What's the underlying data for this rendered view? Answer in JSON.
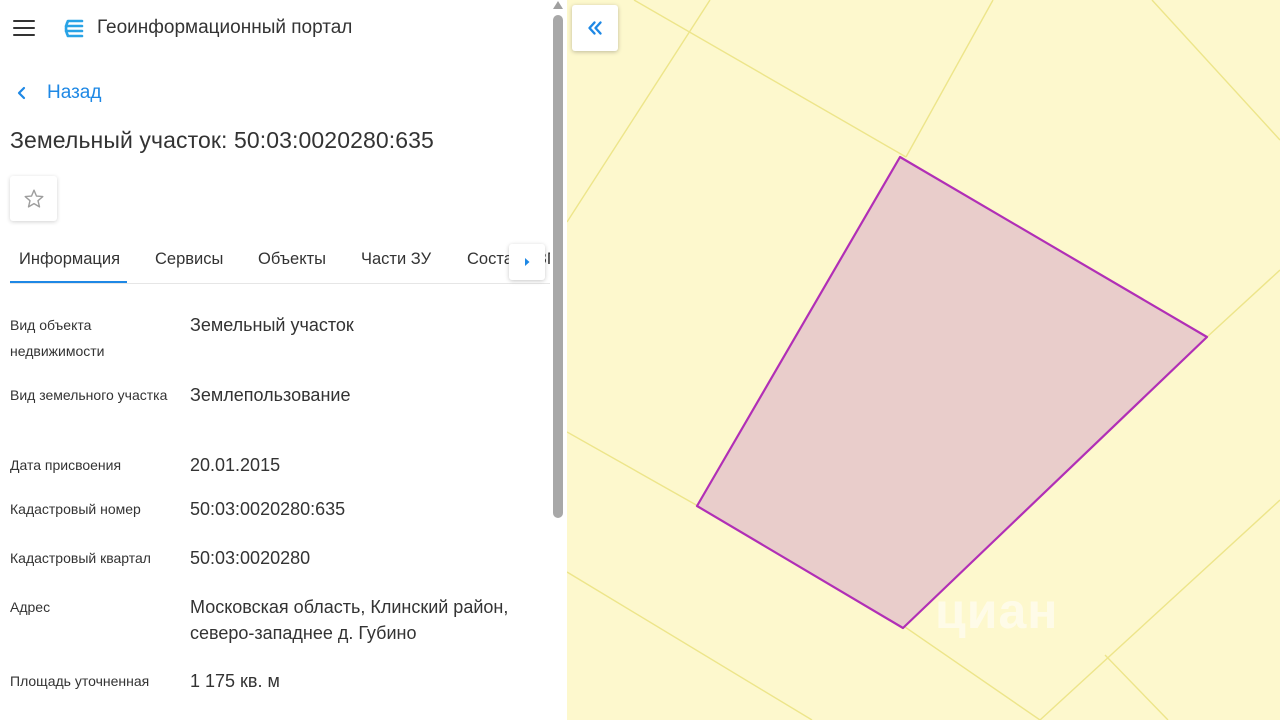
{
  "header": {
    "app_title": "Геоинформационный портал",
    "menu_icon": "hamburger-menu-icon",
    "logo_icon": "portal-logo-icon"
  },
  "navigation": {
    "back_label": "Назад"
  },
  "page": {
    "title": "Земельный участок: 50:03:0020280:635"
  },
  "favorite": {
    "icon": "star-outline-icon"
  },
  "tabs": [
    {
      "label": "Информация",
      "active": true
    },
    {
      "label": "Сервисы",
      "active": false
    },
    {
      "label": "Объекты",
      "active": false
    },
    {
      "label": "Части ЗУ",
      "active": false
    },
    {
      "label": "Состав ЕЗП",
      "active": false
    }
  ],
  "info": [
    {
      "label": "Вид объекта недвижимости",
      "value": "Земельный участок"
    },
    {
      "label": "Вид земельного участка",
      "value": "Землепользование"
    },
    {
      "label": "Дата присвоения",
      "value": "20.01.2015"
    },
    {
      "label": "Кадастровый номер",
      "value": "50:03:0020280:635"
    },
    {
      "label": "Кадастровый квартал",
      "value": "50:03:0020280"
    },
    {
      "label": "Адрес",
      "value": "Московская область, Клинский район, северо-западнее д. Губино"
    },
    {
      "label": "Площадь уточненная",
      "value": "1 175 кв. м"
    }
  ],
  "map": {
    "collapse_icon": "double-chevron-left-icon",
    "background_color": "#fdf8cd",
    "boundary_color": "#ede58a",
    "parcel_fill": "#e9cdcb",
    "parcel_stroke": "#b12fb6",
    "watermark": "циан"
  },
  "colors": {
    "accent": "#1e88e5",
    "text": "#333333"
  }
}
